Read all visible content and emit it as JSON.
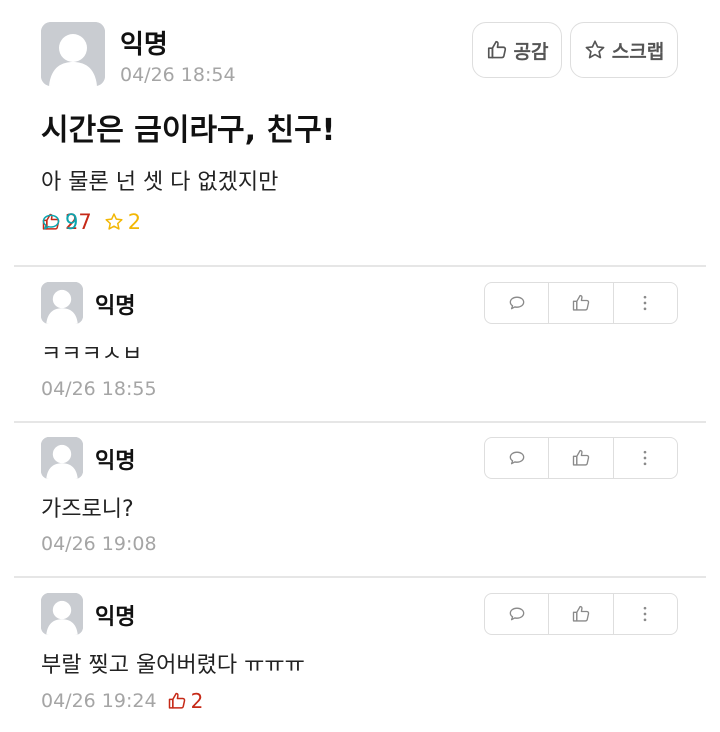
{
  "post": {
    "author": "익명",
    "time": "04/26 18:54",
    "title": "시간은 금이라구, 친구!",
    "body": "아 물론 넌 셋 다 없겠지만",
    "empathy_label": "공감",
    "scrap_label": "스크랩",
    "likes": "27",
    "comments": "9",
    "scraps": "2"
  },
  "comments": [
    {
      "author": "익명",
      "text": "ㅋㅋㅋㅅㅂ",
      "time": "04/26 18:55",
      "likes": ""
    },
    {
      "author": "익명",
      "text": "가즈로니?",
      "time": "04/26 19:08",
      "likes": ""
    },
    {
      "author": "익명",
      "text": "부랄 찢고 울어버렸다 ㅠㅠㅠ",
      "time": "04/26 19:24",
      "likes": "2"
    }
  ],
  "colors": {
    "like": "#c62917",
    "comment": "#0ca5af",
    "scrap": "#f2b705",
    "muted": "#a5a5a5",
    "border": "#dedede"
  },
  "icons": {
    "avatar": "anonymous-avatar-icon",
    "like": "thumbs-up-icon",
    "comment": "speech-bubble-icon",
    "scrap": "star-icon",
    "more": "vertical-dots-icon"
  }
}
